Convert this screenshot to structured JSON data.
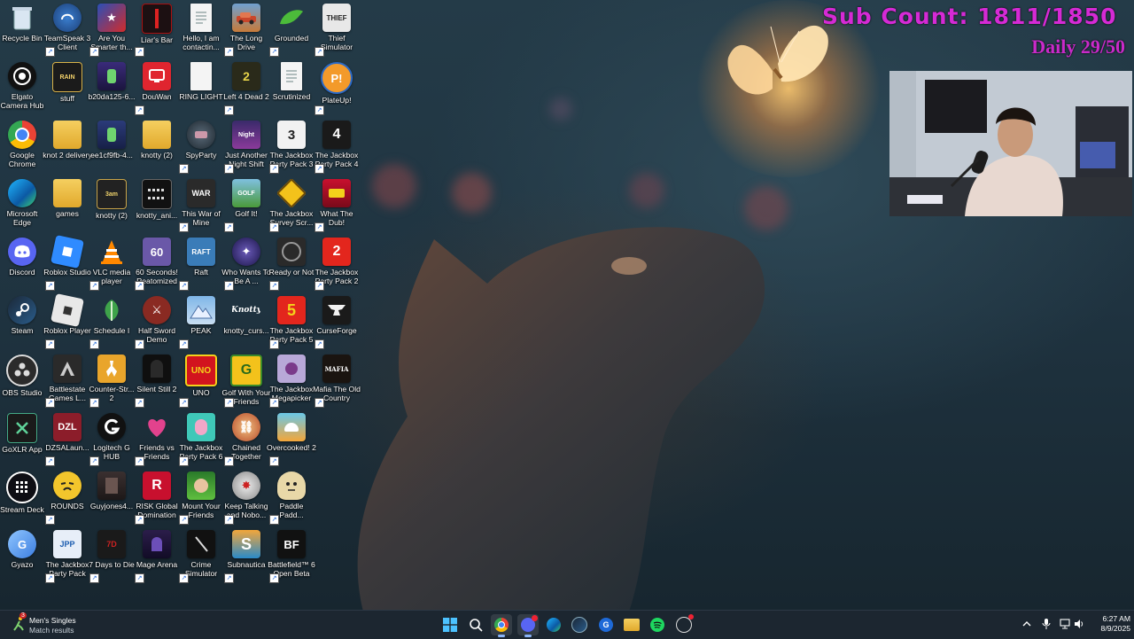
{
  "overlay": {
    "sub_count": "Sub Count: 1811/1850",
    "daily": "Daily 29/50"
  },
  "desktop_icons": [
    [
      "Recycle Bin",
      "TeamSpeak 3 Client",
      "Are You Smarter th...",
      "Liar's Bar",
      "Hello, I am contactin...",
      "The Long Drive",
      "Grounded",
      "Thief Simulator"
    ],
    [
      "Elgato Camera Hub",
      "stuff",
      "b20da125-6...",
      "DouWan",
      "RING LIGHT",
      "Left 4 Dead 2",
      "Scrutinized",
      "PlateUp!"
    ],
    [
      "Google Chrome",
      "knot 2 delivery",
      "ee1cf9fb-4...",
      "knotty (2)",
      "SpyParty",
      "Just Another Night Shift",
      "The Jackbox Party Pack 3",
      "The Jackbox Party Pack 4"
    ],
    [
      "Microsoft Edge",
      "games",
      "knotty (2)",
      "knotty_ani...",
      "This War of Mine",
      "Golf It!",
      "The Jackbox Survey Scr...",
      "What The Dub!"
    ],
    [
      "Discord",
      "Roblox Studio",
      "VLC media player",
      "60 Seconds! Reatomized",
      "Raft",
      "Who Wants To Be A ...",
      "Ready or Not",
      "The Jackbox Party Pack 2"
    ],
    [
      "Steam",
      "Roblox Player",
      "Schedule I",
      "Half Sword Demo",
      "PEAK",
      "knotty_curs...",
      "The Jackbox Party Pack 5",
      "CurseForge"
    ],
    [
      "OBS Studio",
      "Battlestate Games L...",
      "Counter-Str... 2",
      "Silent Still 2",
      "UNO",
      "Golf With Your Friends",
      "The Jackbox Megapicker",
      "Mafia The Old Country"
    ],
    [
      "GoXLR App",
      "DZSALaun...",
      "Logitech G HUB",
      "Friends vs Friends",
      "The Jackbox Party Pack 6",
      "Chained Together",
      "Overcooked! 2",
      ""
    ],
    [
      "Stream Deck",
      "ROUNDS",
      "Guyjones4...",
      "RISK Global Domination",
      "Mount Your Friends",
      "Keep Talking and Nobo...",
      "Paddle Padd...",
      ""
    ],
    [
      "Gyazo",
      "The Jackbox Party Pack",
      "7 Days to Die",
      "Mage Arena",
      "Crime Simulator",
      "Subnautica",
      "Battlefield™ 6 Open Beta",
      ""
    ]
  ],
  "icon_badges": {
    "left4dead": "2",
    "jackbox3": "3",
    "jackbox4": "4",
    "jackbox2": "2",
    "jackbox5": "5",
    "uno": "UNO",
    "golf": "G",
    "mafia": "MAFIA",
    "dzsa": "DZL",
    "subnautica": "S",
    "battlefield": "BF",
    "raft": "RAFT",
    "warofmine": "WAR",
    "riskr": "R"
  },
  "taskbar": {
    "widget_title": "Men's Singles",
    "widget_subtitle": "Match results",
    "widget_badge": "3",
    "clock_time": "6:27 AM",
    "clock_date": "8/9/2025"
  },
  "colors": {
    "overlay_magenta": "#d52ad5",
    "taskbar_bg": "#1c2630",
    "windows_blue": "#4cc2ff"
  }
}
